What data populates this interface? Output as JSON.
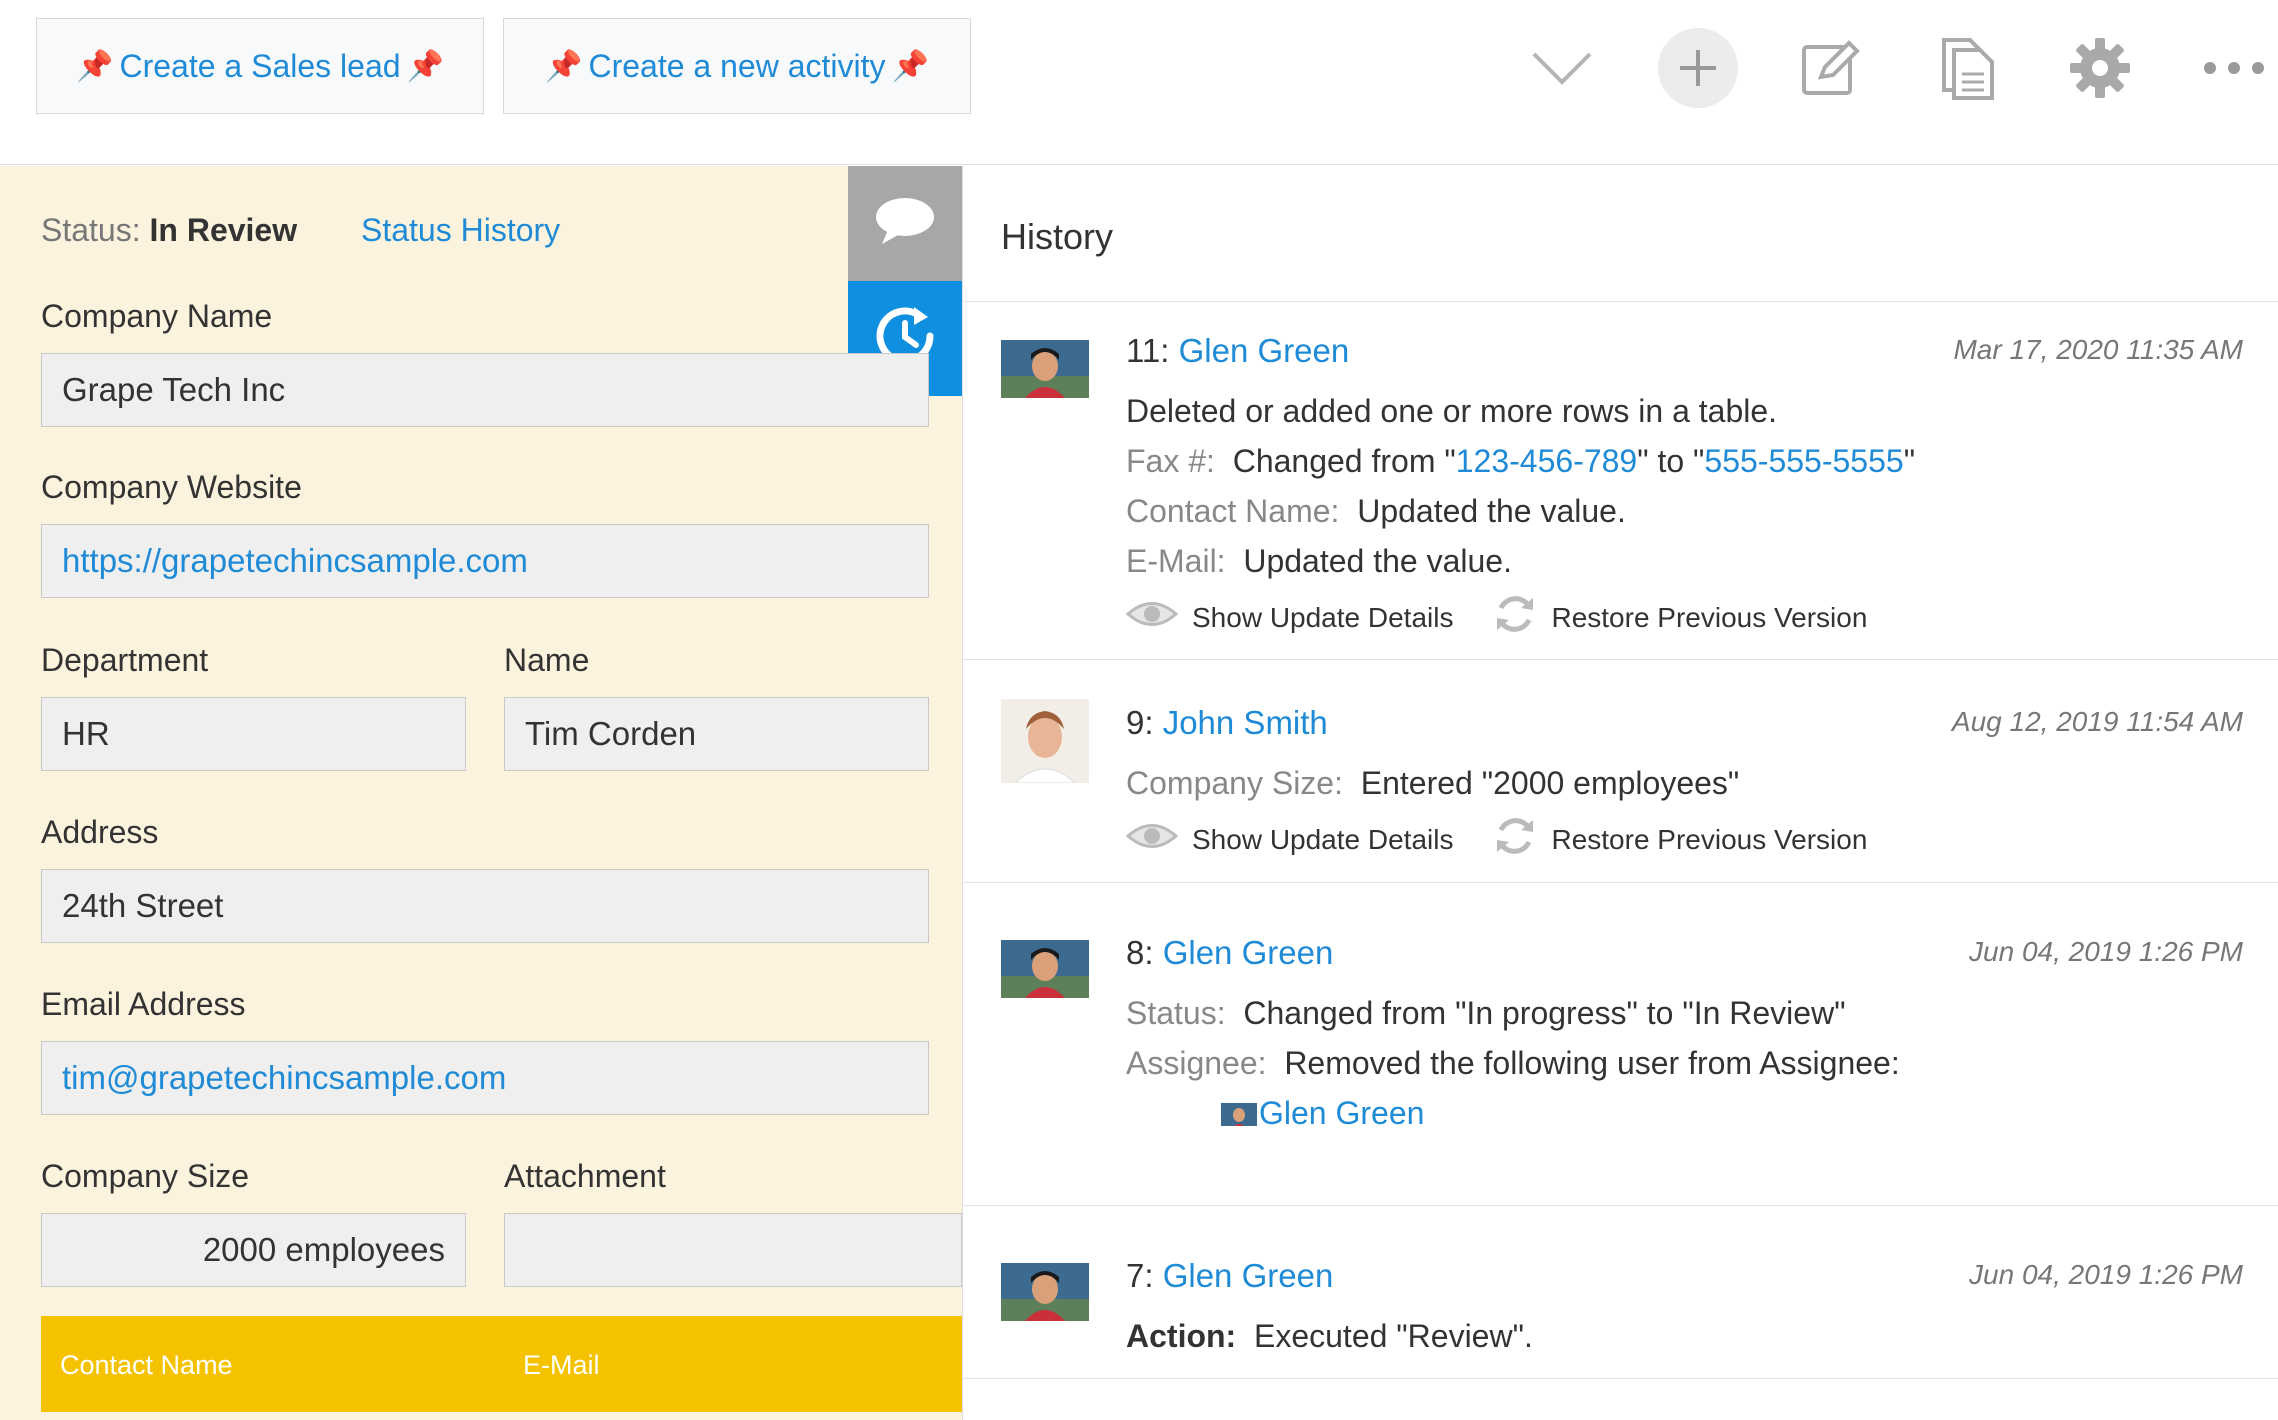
{
  "toolbar": {
    "create_sales_lead": "Create a Sales lead",
    "create_activity": "Create a new activity",
    "pin_glyph": "📌"
  },
  "record": {
    "status_label": "Status:",
    "status_value": "In Review",
    "status_history": "Status History",
    "company_name_label": "Company Name",
    "company_name": "Grape Tech Inc",
    "company_website_label": "Company Website",
    "company_website": "https://grapetechincsample.com",
    "department_label": "Department",
    "department": "HR",
    "name_label": "Name",
    "name": "Tim Corden",
    "address_label": "Address",
    "address": "24th Street",
    "email_label": "Email Address",
    "email": "tim@grapetechincsample.com",
    "company_size_label": "Company Size",
    "company_size": "2000 employees",
    "attachment_label": "Attachment",
    "attachment": "",
    "table_headers": [
      "Contact Name",
      "E-Mail"
    ]
  },
  "history": {
    "title": "History",
    "show_details": "Show Update Details",
    "restore": "Restore Previous Version",
    "entries": [
      {
        "num": "11:",
        "user": "Glen Green",
        "date": "Mar 17, 2020 11:35 AM",
        "line1": "Deleted or added one or more rows in a table.",
        "fax_key": "Fax #:",
        "fax_pre": "Changed from \"",
        "fax_old": "123-456-789",
        "fax_mid": "\" to \"",
        "fax_new": "555-555-5555",
        "fax_post": "\"",
        "contact_key": "Contact Name:",
        "contact_val": "Updated the value.",
        "email_key": "E-Mail:",
        "email_val": "Updated the value."
      },
      {
        "num": "9:",
        "user": "John Smith",
        "date": "Aug 12, 2019 11:54 AM",
        "size_key": "Company Size:",
        "size_val": "Entered \"2000 employees\""
      },
      {
        "num": "8:",
        "user": "Glen Green",
        "date": "Jun 04, 2019 1:26 PM",
        "status_key": "Status:",
        "status_val": "Changed from \"In progress\" to \"In Review\"",
        "assignee_key": "Assignee:",
        "assignee_val": "Removed the following user from Assignee:",
        "removed_user": "Glen Green"
      },
      {
        "num": "7:",
        "user": "Glen Green",
        "date": "Jun 04, 2019 1:26 PM",
        "action_key": "Action:",
        "action_val": "Executed \"Review\"."
      }
    ]
  },
  "colors": {
    "link": "#1f8ad6",
    "panel_bg": "#fbf3dd",
    "table_header": "#f5c200",
    "history_tab": "#0f8fe0"
  },
  "icons": [
    "chevron-down-icon",
    "plus-icon",
    "edit-icon",
    "document-icon",
    "gear-icon",
    "more-icon",
    "comment-icon",
    "history-icon",
    "eye-icon",
    "refresh-icon",
    "pin-icon"
  ]
}
